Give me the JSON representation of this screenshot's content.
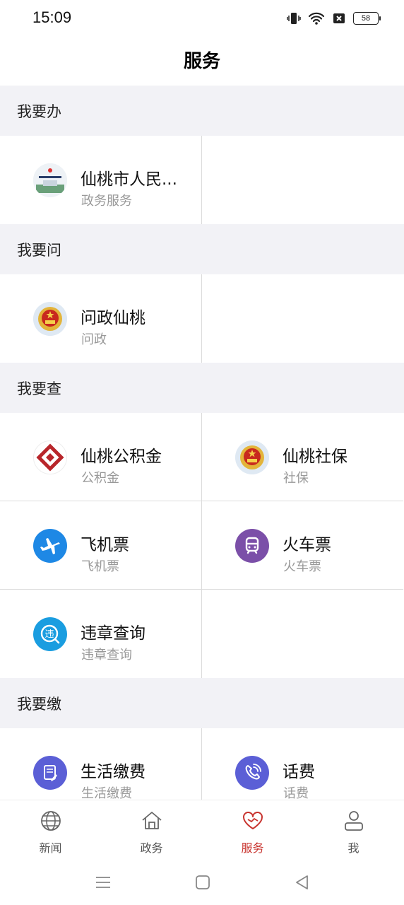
{
  "status": {
    "time": "15:09",
    "battery": "58"
  },
  "header": {
    "title": "服务"
  },
  "sections": [
    {
      "title": "我要办",
      "items": [
        {
          "title": "仙桃市人民...",
          "subtitle": "政务服务",
          "icon": "government-building-icon"
        }
      ]
    },
    {
      "title": "我要问",
      "items": [
        {
          "title": "问政仙桃",
          "subtitle": "问政",
          "icon": "national-emblem-icon"
        }
      ]
    },
    {
      "title": "我要查",
      "items": [
        {
          "title": "仙桃公积金",
          "subtitle": "公积金",
          "icon": "housing-fund-icon"
        },
        {
          "title": "仙桃社保",
          "subtitle": "社保",
          "icon": "national-emblem-icon"
        },
        {
          "title": "飞机票",
          "subtitle": "飞机票",
          "icon": "airplane-icon"
        },
        {
          "title": "火车票",
          "subtitle": "火车票",
          "icon": "train-icon"
        },
        {
          "title": "违章查询",
          "subtitle": "违章查询",
          "icon": "violation-search-icon"
        }
      ]
    },
    {
      "title": "我要缴",
      "items": [
        {
          "title": "生活缴费",
          "subtitle": "生活缴费",
          "icon": "bill-payment-icon"
        },
        {
          "title": "话费",
          "subtitle": "话费",
          "icon": "phone-bill-icon"
        }
      ]
    }
  ],
  "icon_text": {
    "violation": "违"
  },
  "tabs": [
    {
      "label": "新闻",
      "icon": "globe-icon"
    },
    {
      "label": "政务",
      "icon": "home-icon"
    },
    {
      "label": "服务",
      "icon": "heart-icon",
      "active": true
    },
    {
      "label": "我",
      "icon": "person-icon"
    }
  ],
  "colors": {
    "accent": "#c8332e",
    "airplane": "#1e88e5",
    "train": "#7b4fa8",
    "violation": "#1a9de0",
    "bill": "#5b5fd6"
  }
}
